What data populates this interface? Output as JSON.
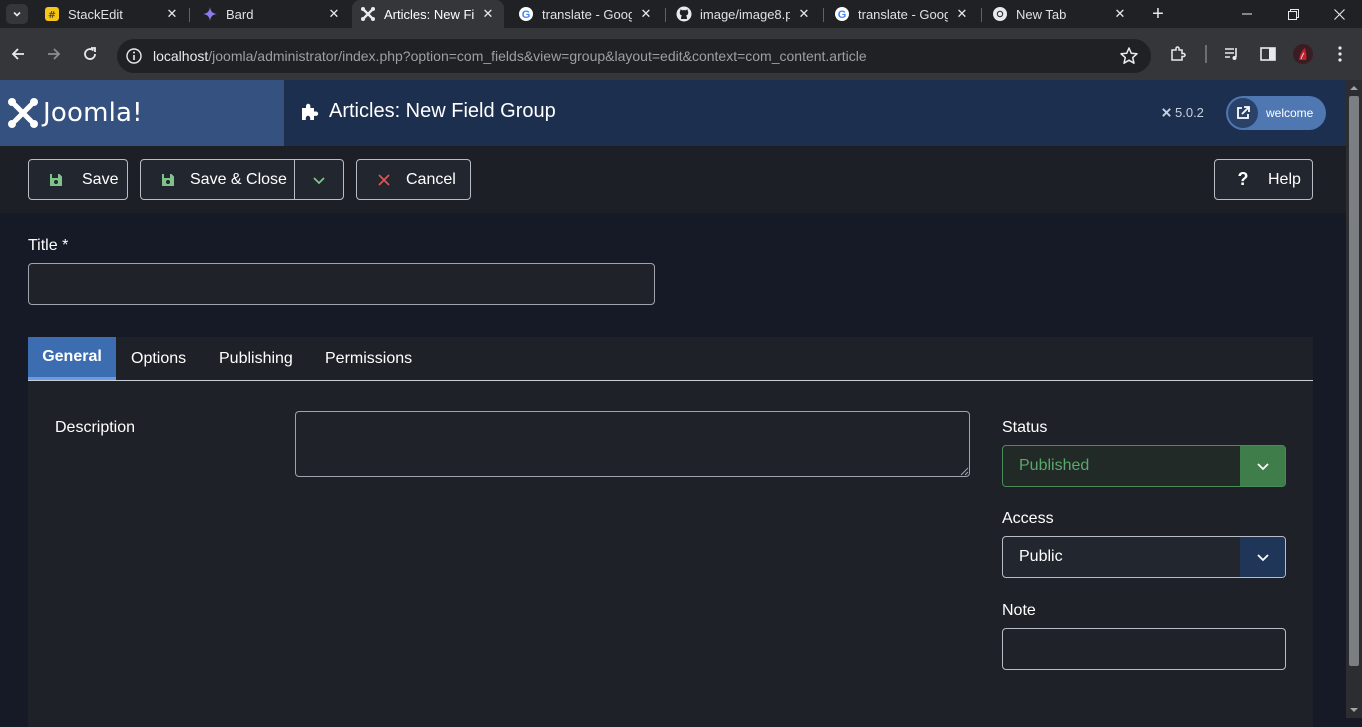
{
  "browser": {
    "tabs": [
      {
        "label": "StackEdit",
        "icon": "stackedit-icon"
      },
      {
        "label": "Bard",
        "icon": "bard-sparkle-icon"
      },
      {
        "label": "Articles: New Fie",
        "icon": "joomla-icon",
        "active": true
      },
      {
        "label": "translate - Goog",
        "icon": "google-icon"
      },
      {
        "label": "image/image8.p",
        "icon": "github-icon"
      },
      {
        "label": "translate - Goog",
        "icon": "google-icon"
      },
      {
        "label": "New Tab",
        "icon": "chrome-icon"
      }
    ],
    "url_host": "localhost",
    "url_path": "/joomla/administrator/index.php?option=com_fields&view=group&layout=edit&context=com_content.article"
  },
  "header": {
    "logo_text": "Joomla!",
    "page_title": "Articles: New Field Group",
    "version": "5.0.2",
    "user_menu_label": "welcome"
  },
  "toolbar": {
    "save_label": "Save",
    "save_close_label": "Save & Close",
    "cancel_label": "Cancel",
    "help_label": "Help"
  },
  "form": {
    "title_label": "Title *",
    "title_value": "",
    "tabs": [
      "General",
      "Options",
      "Publishing",
      "Permissions"
    ],
    "active_tab": "General",
    "description_label": "Description",
    "status_label": "Status",
    "status_value": "Published",
    "access_label": "Access",
    "access_value": "Public",
    "note_label": "Note",
    "note_value": ""
  },
  "colors": {
    "header_bg": "#1c2f4e",
    "logo_bg": "#34517f",
    "active_tab": "#3c6db0",
    "status_green": "#3f7d4a",
    "welcome_pill": "#4f77b2"
  }
}
